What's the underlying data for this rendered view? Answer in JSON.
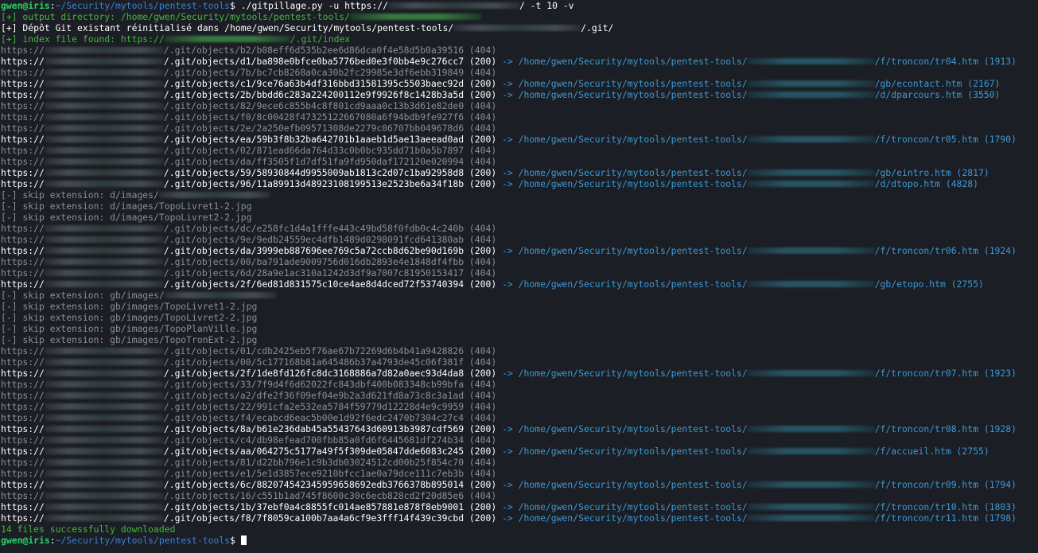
{
  "prompt": {
    "user": "gwen@iris",
    "sep": ":",
    "cwd": "~/Security/mytools/pentest-tools",
    "symbol": "$"
  },
  "command": {
    "prefix": "./gitpillage.py -u https://",
    "suffix": "/ -t 10 -v"
  },
  "header_lines": [
    {
      "cls": "c-green",
      "pre": "[+] output directory: /home/gwen/Security/mytools/pentest-tools/",
      "post": "",
      "redact": "green",
      "rw": 165
    },
    {
      "cls": "c-white",
      "pre": "[+] Dépôt Git existant réinitialisé dans /home/gwen/Security/mytools/pentest-tools/",
      "post": "/.git/",
      "redact": "normal",
      "rw": 160
    },
    {
      "cls": "c-green",
      "pre": "[+] index file found: https://",
      "post": "/.git/index",
      "redact": "green",
      "rw": 158
    }
  ],
  "log_lines": [
    {
      "t": "o",
      "hash": "b2/b08eff6d535b2ee6d86dca0f4e58d5b0a39516",
      "code": "404"
    },
    {
      "t": "o",
      "hash": "d1/ba898e0bfce0ba5776bed0e3f0bb4e9c276cc7",
      "code": "200",
      "dest": "f/troncon/tr04.htm",
      "size": "1913"
    },
    {
      "t": "o",
      "hash": "7b/bc7cb8268a0ca30b2fc29985e3df6ebb319849",
      "code": "404"
    },
    {
      "t": "o",
      "hash": "c1/9ce76a63b4df316bbd31581395c5503baec92d",
      "code": "200",
      "dest": "gb/econtact.htm",
      "size": "2167"
    },
    {
      "t": "o",
      "hash": "2b/bbdd6c283a224200112e9f9926f8c1428b3a5d",
      "code": "200",
      "dest": "d/dparcours.htm",
      "size": "3550"
    },
    {
      "t": "o",
      "hash": "82/9ece6c855b4c8f801cd9aaa0c13b3d61e82de0",
      "code": "404"
    },
    {
      "t": "o",
      "hash": "f0/8c00428f47325122667080a6f94bdb9fe927f6",
      "code": "404"
    },
    {
      "t": "o",
      "hash": "2e/2a250efb09571308de2279c06707bb049678d6",
      "code": "404"
    },
    {
      "t": "o",
      "hash": "ea/59b3f8b32ba642701b1aaeb1d5ae13aeead0ad",
      "code": "200",
      "dest": "f/troncon/tr05.htm",
      "size": "1790"
    },
    {
      "t": "o",
      "hash": "02/871ead66da764d33c0b0bc935dd71b0a5b7897",
      "code": "404"
    },
    {
      "t": "o",
      "hash": "da/ff3505f1d7df51fa9fd950daf172120e020994",
      "code": "404"
    },
    {
      "t": "o",
      "hash": "59/58930844d9955009ab1813c2d07c1ba92958d8",
      "code": "200",
      "dest": "gb/eintro.htm",
      "size": "2817"
    },
    {
      "t": "o",
      "hash": "96/11a89913d48923108199513e2523be6a34f18b",
      "code": "200",
      "dest": "d/dtopo.htm",
      "size": "4828"
    },
    {
      "t": "s",
      "text": "[-] skip extension: d/images/",
      "redact": true
    },
    {
      "t": "s",
      "text": "[-] skip extension: d/images/TopoLivret1-2.jpg"
    },
    {
      "t": "s",
      "text": "[-] skip extension: d/images/TopoLivret2-2.jpg"
    },
    {
      "t": "o",
      "hash": "dc/e258fc1d4a1fffe443c49bd58f0fdb0c4c240b",
      "code": "404"
    },
    {
      "t": "o",
      "hash": "9e/9edb24559ec4dfb1489d0298091fcd641380ab",
      "code": "404"
    },
    {
      "t": "o",
      "hash": "da/3999eb887696ee769c5a72ccb8d62be90d169b",
      "code": "200",
      "dest": "f/troncon/tr06.htm",
      "size": "1924"
    },
    {
      "t": "o",
      "hash": "00/ba791ade9009756d016db2893e4e1848df4fbb",
      "code": "404"
    },
    {
      "t": "o",
      "hash": "6d/28a9e1ac310a1242d3df9a7007c81950153417",
      "code": "404"
    },
    {
      "t": "o",
      "hash": "2f/6ed81d831575c10ce4ae8d4dced72f53740394",
      "code": "200",
      "dest": "gb/etopo.htm",
      "size": "2755"
    },
    {
      "t": "s",
      "text": "[-] skip extension: gb/images/",
      "redact": true
    },
    {
      "t": "s",
      "text": "[-] skip extension: gb/images/TopoLivret1-2.jpg"
    },
    {
      "t": "s",
      "text": "[-] skip extension: gb/images/TopoLivret2-2.jpg"
    },
    {
      "t": "s",
      "text": "[-] skip extension: gb/images/TopoPlanVille.jpg"
    },
    {
      "t": "s",
      "text": "[-] skip extension: gb/images/TopoTronExt-2.jpg"
    },
    {
      "t": "o",
      "hash": "01/cdb2425eb5f76ae67b72269d6b4b41a9428826",
      "code": "404"
    },
    {
      "t": "o",
      "hash": "00/5c177168b81a645486b37a4793de45c06f381f",
      "code": "404"
    },
    {
      "t": "o",
      "hash": "2f/1de8fd126fc8dc3168886a7d82a0aec93d4da8",
      "code": "200",
      "dest": "f/troncon/tr07.htm",
      "size": "1923"
    },
    {
      "t": "o",
      "hash": "33/7f9d4f6d62022fc843dbf400b083348cb99bfa",
      "code": "404"
    },
    {
      "t": "o",
      "hash": "a2/dfe2f36f09ef04e9b2a3d621fd8a73c8c3a1ad",
      "code": "404"
    },
    {
      "t": "o",
      "hash": "22/991cfa2e532ea5784f59779d12228d4e9c9959",
      "code": "404"
    },
    {
      "t": "o",
      "hash": "f4/ecabcd6eac5b00e1d92f6edc2470b7304c27c4",
      "code": "404"
    },
    {
      "t": "o",
      "hash": "8a/b61e236dab45a55437643d60913b3987cdf569",
      "code": "200",
      "dest": "f/troncon/tr08.htm",
      "size": "1928"
    },
    {
      "t": "o",
      "hash": "c4/db98efead700fbb85a0fd6f6445681df274b34",
      "code": "404"
    },
    {
      "t": "o",
      "hash": "aa/064275c5177a49f5f309de05847dde6083c245",
      "code": "200",
      "dest": "f/accueil.htm",
      "size": "2755"
    },
    {
      "t": "o",
      "hash": "81/d22bb796e1c9b3db03024512cd00b25f854c70",
      "code": "404"
    },
    {
      "t": "o",
      "hash": "e1/5e1d3857ece9210bfcc1ae0a79dce111c7eb3b",
      "code": "404"
    },
    {
      "t": "o",
      "hash": "6c/882074542345959658692edb3766378b895014",
      "code": "200",
      "dest": "f/troncon/tr09.htm",
      "size": "1794"
    },
    {
      "t": "o",
      "hash": "16/c551b1ad745f8600c30c6ecb828cd2f20d85e6",
      "code": "404"
    },
    {
      "t": "o",
      "hash": "1b/37ebf0a4c8855fc014ae857881e878f8eb9001",
      "code": "200",
      "dest": "f/troncon/tr10.htm",
      "size": "1803"
    },
    {
      "t": "o",
      "hash": "f8/7f8059ca100b7aa4a6cf9e3fff14f439c39cbd",
      "code": "200",
      "dest": "f/troncon/tr11.htm",
      "size": "1798"
    }
  ],
  "strings": {
    "url_prefix": "https://",
    "git_objects": "/.git/objects/",
    "arrow": " -> ",
    "dest_prefix": "/home/gwen/Security/mytools/pentest-tools/"
  },
  "summary": "14 files successfully downloaded",
  "colors": {
    "background": "#1b1e24",
    "prompt_user": "#2bd26a",
    "prompt_path": "#3f7fd4",
    "success": "#46b540",
    "found": "#ffffff",
    "not_found": "#8a8f97",
    "destination": "#3b9ad6"
  }
}
